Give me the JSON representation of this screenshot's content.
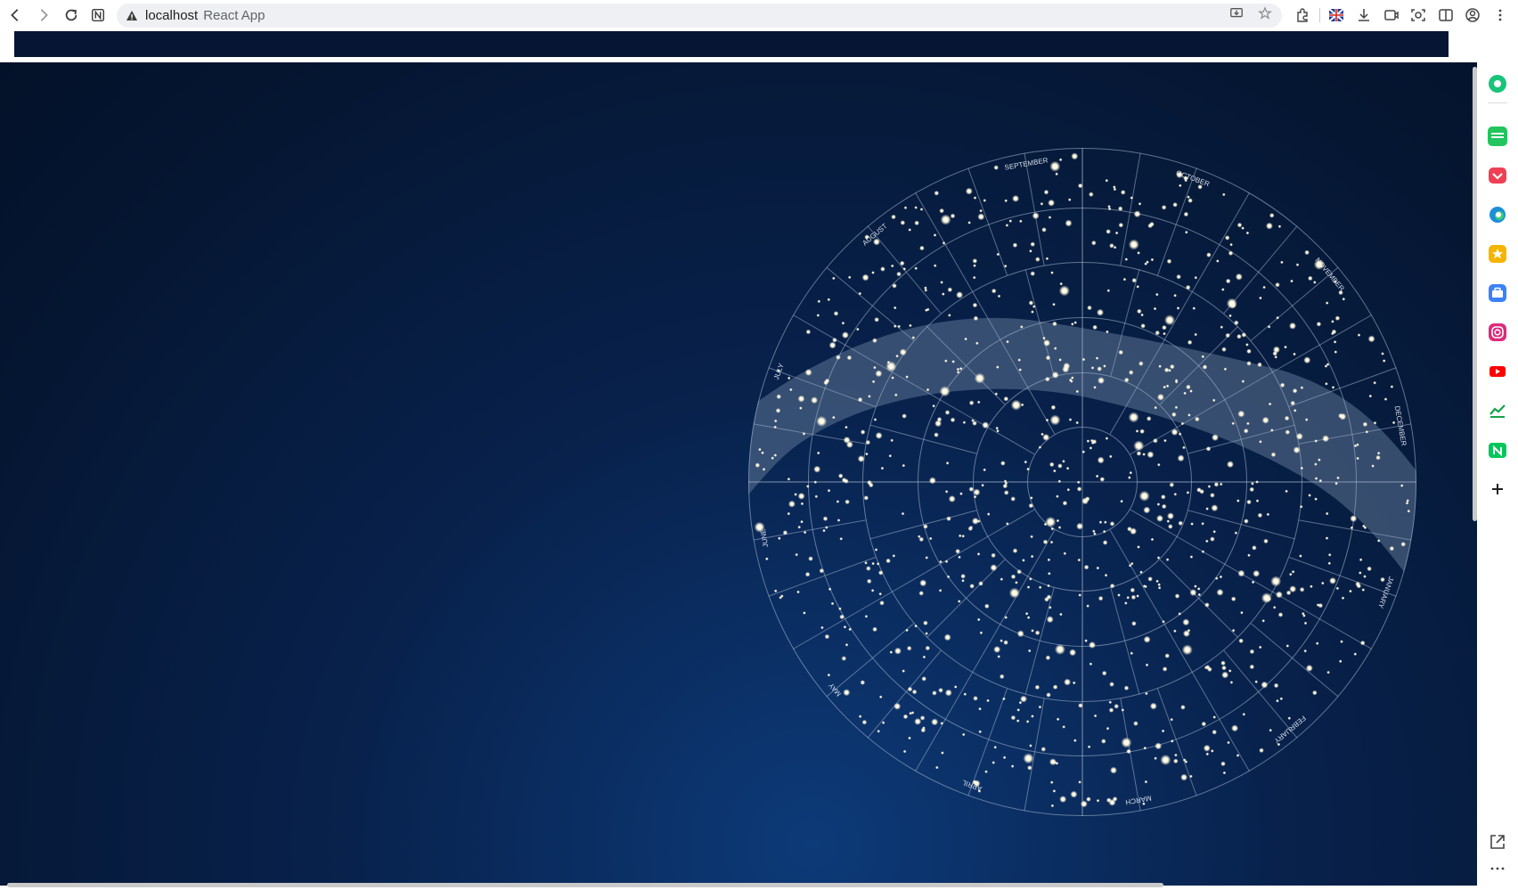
{
  "browser": {
    "host": "localhost",
    "page_title": "React App"
  },
  "app": {
    "month_labels": [
      "SEPTEMBER",
      "OCTOBER",
      "NOVEMBER",
      "DECEMBER",
      "JANUARY",
      "FEBRUARY",
      "MARCH",
      "APRIL",
      "MAY",
      "JUNE",
      "JULY",
      "AUGUST"
    ],
    "colors": {
      "background": "#051632",
      "header_bar": "#061533",
      "grid_lines": "#9fb0c8",
      "stars": "#fffbe8",
      "milky_way": "#5d7594"
    }
  },
  "sidebar": {
    "items": [
      {
        "name": "green-circle-icon",
        "color": "#18c47a"
      },
      {
        "name": "webtoon-icon",
        "color": "#22c55e"
      },
      {
        "name": "pocket-icon",
        "color": "#ef4056"
      },
      {
        "name": "edge-icon",
        "color": "#1d8fd9"
      },
      {
        "name": "favorites-star-icon",
        "color": "#f5b400"
      },
      {
        "name": "briefcase-icon",
        "color": "#3b82f6"
      },
      {
        "name": "instagram-icon",
        "color": "#dd2a7b"
      },
      {
        "name": "youtube-icon",
        "color": "#ff0000"
      },
      {
        "name": "chart-icon",
        "color": "#16a34a"
      },
      {
        "name": "naver-icon",
        "color": "#03c75a"
      }
    ]
  }
}
